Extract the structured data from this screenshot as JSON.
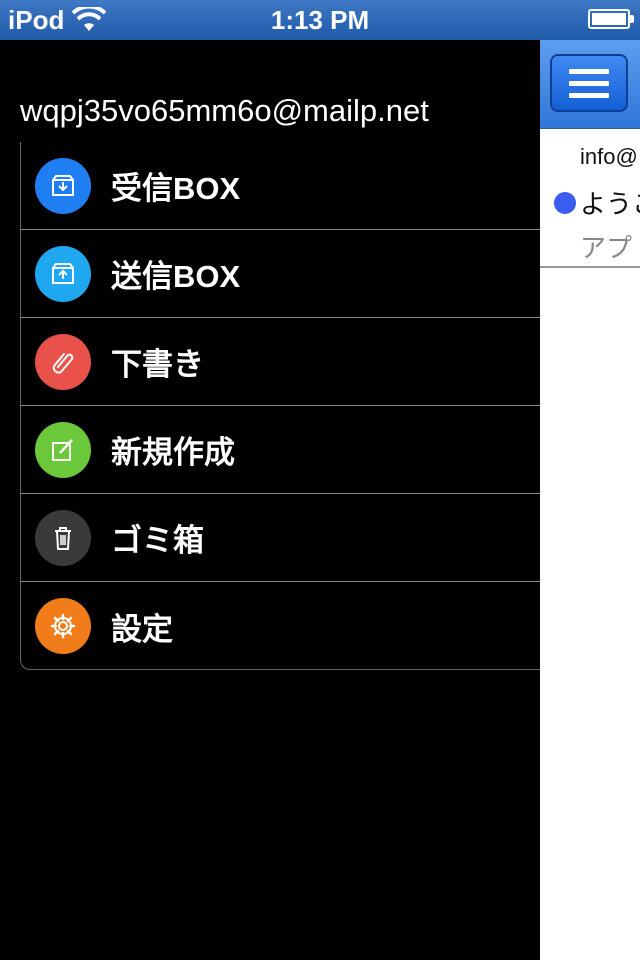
{
  "status_bar": {
    "carrier": "iPod",
    "time": "1:13 PM"
  },
  "account": {
    "email": "wqpj35vo65mm6o@mailp.net"
  },
  "menu": {
    "items": [
      {
        "label": "受信BOX",
        "icon": "inbox-icon",
        "color": "#1e7ef2"
      },
      {
        "label": "送信BOX",
        "icon": "outbox-icon",
        "color": "#1fa8f0"
      },
      {
        "label": "下書き",
        "icon": "paperclip-icon",
        "color": "#e8524a"
      },
      {
        "label": "新規作成",
        "icon": "compose-icon",
        "color": "#6cc83b"
      },
      {
        "label": "ゴミ箱",
        "icon": "trash-icon",
        "color": "#3a3a3a"
      },
      {
        "label": "設定",
        "icon": "gear-icon",
        "color": "#f07d1a"
      }
    ]
  },
  "content": {
    "message": {
      "from": "info@",
      "subject": "ようこ",
      "preview": "アプ"
    }
  },
  "colors": {
    "accent": "#2f76d8",
    "background": "#000000"
  }
}
